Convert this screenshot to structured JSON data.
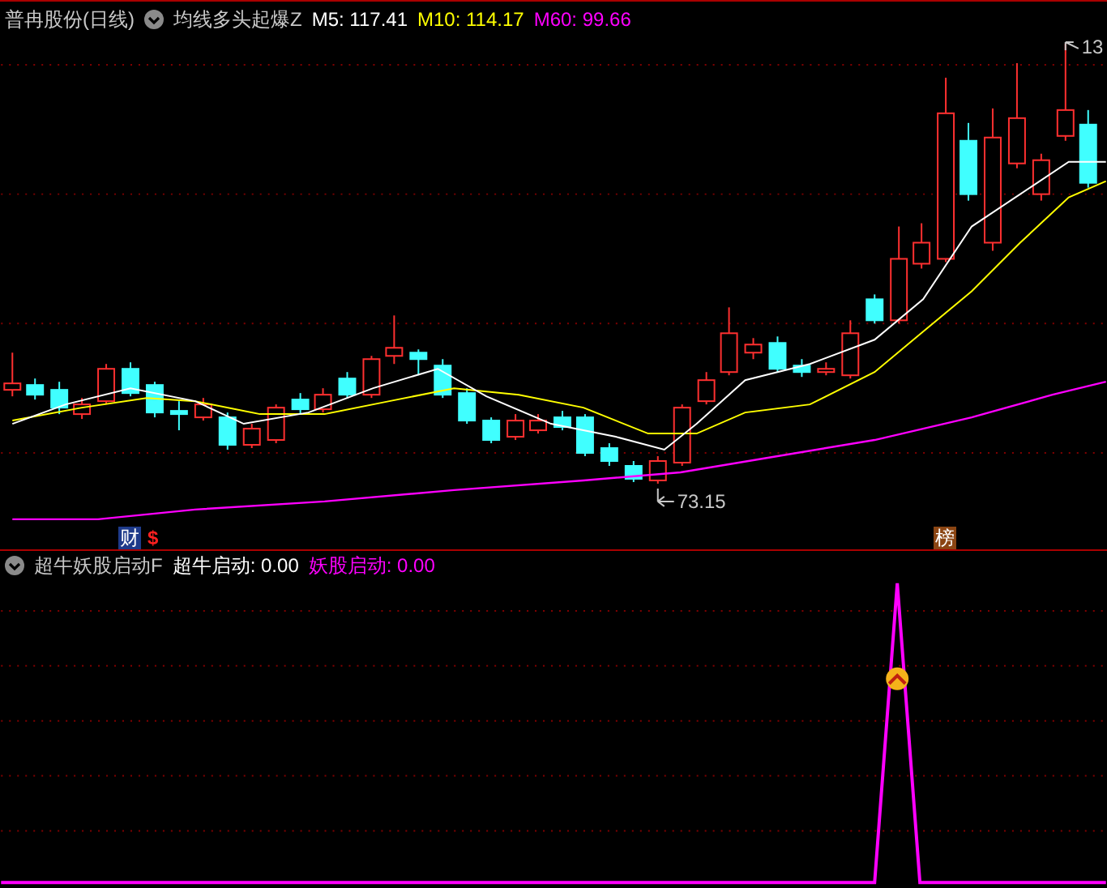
{
  "main_panel": {
    "stock": "普冉股份(日线)",
    "indicator": "均线多头起爆Z",
    "legend": [
      {
        "label": "M5: 117.41",
        "color": "#ffffff"
      },
      {
        "label": "M10: 114.17",
        "color": "#ffff00"
      },
      {
        "label": "M60: 99.66",
        "color": "#ff00ff"
      }
    ],
    "high_label": "13",
    "low_label": "73.15"
  },
  "markers": [
    {
      "text": "财",
      "kind": "finance"
    },
    {
      "text": "$",
      "kind": "dollar"
    },
    {
      "text": "榜",
      "kind": "rank"
    }
  ],
  "sub_panel": {
    "indicator": "超牛妖股启动F",
    "legend": [
      {
        "label": "超牛启动: 0.00",
        "color": "#ffffff"
      },
      {
        "label": "妖股启动: 0.00",
        "color": "#ff00ff"
      }
    ]
  }
}
